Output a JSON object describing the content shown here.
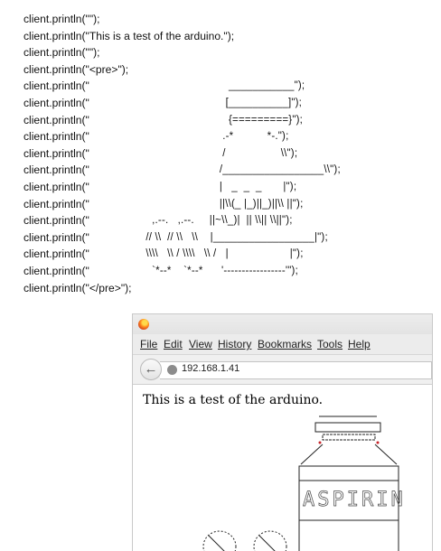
{
  "code": {
    "lines": [
      {
        "kw": "client.println(\"\");",
        "art": ""
      },
      {
        "kw": "client.println(\"This is a test of the arduino.\");",
        "art": ""
      },
      {
        "kw": "client.println(\"\");",
        "art": ""
      },
      {
        "kw": "client.println(\"<pre>\");",
        "art": ""
      },
      {
        "kw": "client.println(\"",
        "art": "                                      ___________\");"
      },
      {
        "kw": "client.println(\"",
        "art": "                                     [__________]\");"
      },
      {
        "kw": "client.println(\"",
        "art": "                                      {=========}\");"
      },
      {
        "kw": "client.println(\"",
        "art": "                                    .-*           *-.\");"
      },
      {
        "kw": "client.println(\"",
        "art": "                                    /                  \\\\\");"
      },
      {
        "kw": "client.println(\"",
        "art": "                                   /_________________\\\\\");"
      },
      {
        "kw": "client.println(\"",
        "art": "                                   |   _  _  _       |\");"
      },
      {
        "kw": "client.println(\"",
        "art": "                                   ||\\\\(_ |_)||_)||\\\\ ||\");"
      },
      {
        "kw": "client.println(\"",
        "art": "             ,.--.   ,.--.     ||~\\\\_)|  || \\\\|| \\\\||\");"
      },
      {
        "kw": "client.println(\"",
        "art": "           // \\\\  // \\\\   \\\\    |_________________|\");"
      },
      {
        "kw": "client.println(\"",
        "art": "           \\\\\\\\   \\\\ / \\\\\\\\   \\\\ /   |                    |\");"
      },
      {
        "kw": "client.println(\"",
        "art": "             `*--*    `*--*      '-----------------'\");"
      },
      {
        "kw": "client.println(\"</pre>\");",
        "art": ""
      }
    ]
  },
  "browser": {
    "menu": [
      "File",
      "Edit",
      "View",
      "History",
      "Bookmarks",
      "Tools",
      "Help"
    ],
    "back_symbol": "←",
    "url": "192.168.1.41",
    "page_text": "This is a test of the arduino."
  }
}
